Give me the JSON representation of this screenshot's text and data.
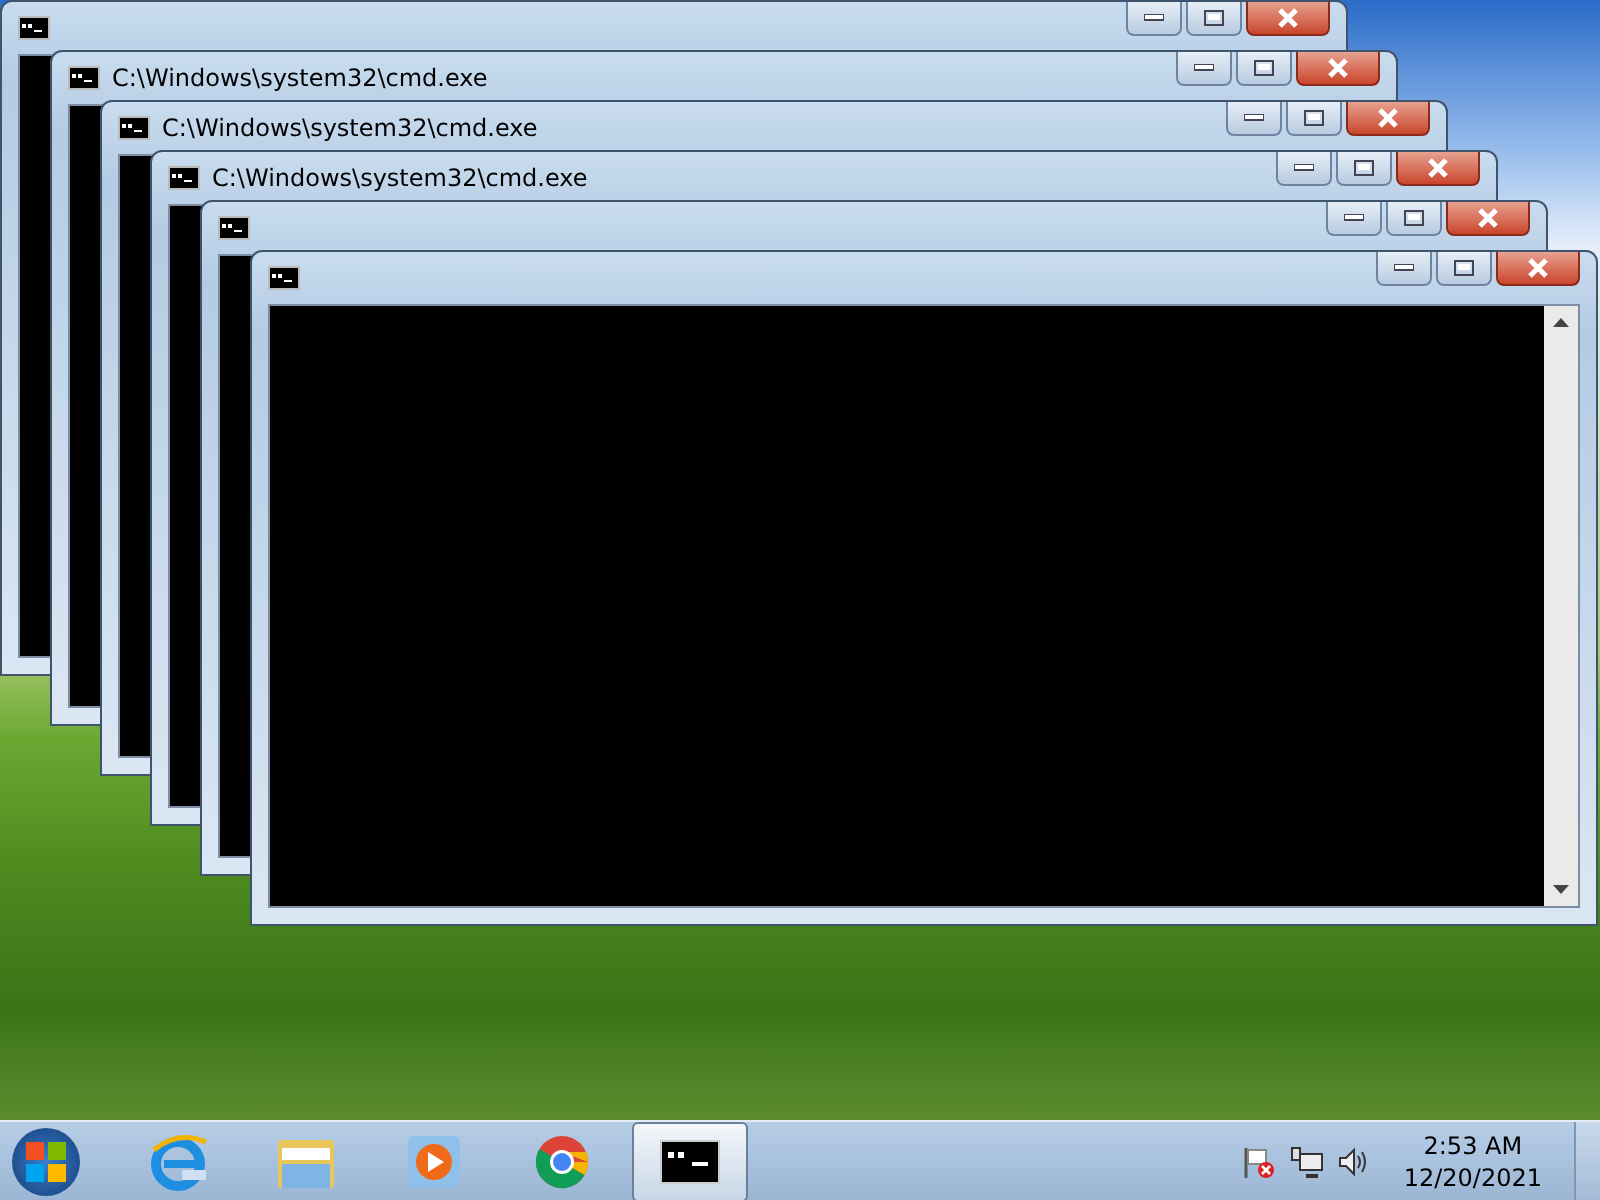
{
  "windows": [
    {
      "kind": "console"
    },
    {
      "kind": "console",
      "title": "C:\\Windows\\system32\\cmd.exe"
    },
    {
      "kind": "console",
      "title": "C:\\Windows\\system32\\cmd.exe"
    },
    {
      "kind": "console",
      "title": "C:\\Windows\\system32\\cmd.exe"
    },
    {
      "kind": "console"
    },
    {
      "kind": "console"
    }
  ],
  "taskbar": {
    "apps": [
      {
        "kind": "browser-e",
        "active": false
      },
      {
        "kind": "folder",
        "active": false
      },
      {
        "kind": "media",
        "active": false
      },
      {
        "kind": "chrome",
        "active": false
      },
      {
        "kind": "console",
        "active": true
      }
    ],
    "clock": {
      "time": "2:53 AM",
      "date": "12/20/2021"
    }
  }
}
